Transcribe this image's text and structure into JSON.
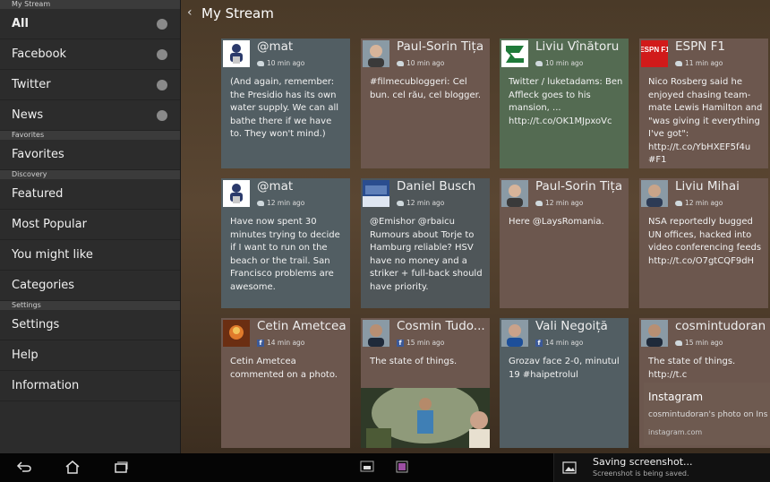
{
  "sidebar": {
    "sections": [
      {
        "header": "My Stream",
        "items": [
          {
            "label": "All",
            "active": true,
            "dot": true
          },
          {
            "label": "Facebook",
            "dot": true
          },
          {
            "label": "Twitter",
            "dot": true
          },
          {
            "label": "News",
            "dot": true
          }
        ]
      },
      {
        "header": "Favorites",
        "items": [
          {
            "label": "Favorites"
          }
        ]
      },
      {
        "header": "Discovery",
        "items": [
          {
            "label": "Featured"
          },
          {
            "label": "Most Popular"
          },
          {
            "label": "You might like"
          },
          {
            "label": "Categories"
          }
        ]
      },
      {
        "header": "Settings",
        "items": [
          {
            "label": "Settings"
          },
          {
            "label": "Help"
          },
          {
            "label": "Information"
          }
        ]
      }
    ]
  },
  "header": {
    "back_icon": "chevron-left-icon",
    "title": "My Stream"
  },
  "cards": [
    {
      "name": "@mat",
      "source": "twitter",
      "time": "10 min ago",
      "text": "(And again, remember: the Presidio has its own water supply. We can all bathe there if we have to. They won't mind.)",
      "color": "slate",
      "avatar": "mat"
    },
    {
      "name": "Paul-Sorin Tița",
      "source": "twitter",
      "time": "10 min ago",
      "text": "#filmecubloggeri: Cel bun. cel rău, cel blogger.",
      "color": "brown",
      "avatar": "person"
    },
    {
      "name": "Liviu Vînătoru",
      "source": "twitter",
      "time": "10 min ago",
      "text": "Twitter / luketadams: Ben Affleck goes to his mansion, ... http://t.co/OK1MJpxoVc",
      "color": "green",
      "avatar": "green-logo"
    },
    {
      "name": "ESPN F1",
      "source": "twitter",
      "time": "11 min ago",
      "text": "Nico Rosberg said he enjoyed chasing team-mate Lewis Hamilton and \"was giving it everything I've got\": http://t.co/YbHXEF5f4u #F1",
      "color": "brown",
      "avatar": "espn",
      "logo_text": "ESPN F1"
    },
    {
      "name": "@mat",
      "source": "twitter",
      "time": "12 min ago",
      "text": "Have now spent 30 minutes trying to decide if I want to run on the beach or the trail. San Francisco problems are awesome.",
      "color": "slate",
      "avatar": "mat"
    },
    {
      "name": "Daniel Busch",
      "source": "twitter",
      "time": "12 min ago",
      "text": "@Emishor @rbaicu Rumours about Torje to Hamburg reliable? HSV have no money and a striker + full-back should have priority.",
      "color": "dgray",
      "avatar": "stadium"
    },
    {
      "name": "Paul-Sorin Tița",
      "source": "twitter",
      "time": "12 min ago",
      "text": "Here @LaysRomania.",
      "color": "brown",
      "avatar": "person"
    },
    {
      "name": "Liviu Mihai",
      "source": "twitter",
      "time": "12 min ago",
      "text": "NSA reportedly bugged UN offices, hacked into video conferencing feeds http://t.co/O7gtCQF9dH",
      "color": "brown",
      "avatar": "person2"
    },
    {
      "name": "Cetin Ametcea",
      "source": "facebook",
      "time": "14 min ago",
      "text": "Cetin Ametcea commented on a photo.",
      "color": "brown",
      "avatar": "fire"
    },
    {
      "name": "Cosmin Tudo...",
      "source": "facebook",
      "time": "15 min ago",
      "text": "The state of things.",
      "color": "brown",
      "avatar": "person3",
      "has_photo": true
    },
    {
      "name": "Vali Negoiță",
      "source": "facebook",
      "time": "14 min ago",
      "text": "Grozav face 2-0, minutul 19 #haipetrolul",
      "color": "slate",
      "avatar": "person4"
    },
    {
      "name": "cosmintudoran",
      "source": "twitter",
      "time": "15 min ago",
      "text": "The state of things. http://t.c",
      "color": "brown",
      "avatar": "person3",
      "link": {
        "title": "Instagram",
        "desc": "cosmintudoran's photo on Ins",
        "url": "instagram.com"
      }
    }
  ],
  "navbar": {
    "icons": [
      "back-nav-icon",
      "home-nav-icon",
      "recent-apps-icon",
      "small-app-icon",
      "small-app-2-icon"
    ]
  },
  "toast": {
    "title": "Saving screenshot...",
    "subtitle": "Screenshot is being saved.",
    "icon": "image-icon"
  }
}
